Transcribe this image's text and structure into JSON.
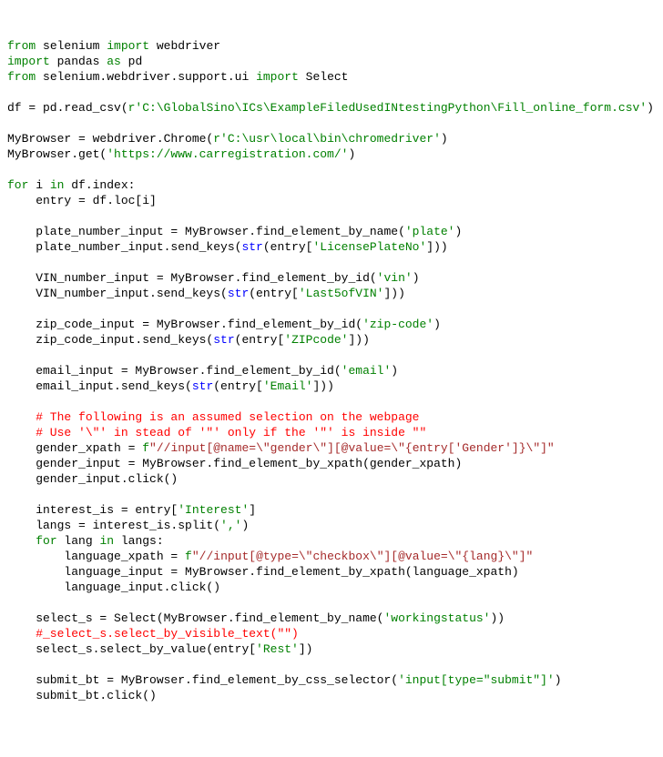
{
  "lines": [
    [
      {
        "t": "from",
        "c": "kw"
      },
      {
        "t": " selenium ",
        "c": "def"
      },
      {
        "t": "import",
        "c": "kw"
      },
      {
        "t": " webdriver",
        "c": "def"
      }
    ],
    [
      {
        "t": "import",
        "c": "kw"
      },
      {
        "t": " pandas ",
        "c": "def"
      },
      {
        "t": "as",
        "c": "kw"
      },
      {
        "t": " pd",
        "c": "def"
      }
    ],
    [
      {
        "t": "from",
        "c": "kw"
      },
      {
        "t": " selenium.webdriver.support.ui ",
        "c": "def"
      },
      {
        "t": "import",
        "c": "kw"
      },
      {
        "t": " Select",
        "c": "def"
      }
    ],
    [],
    [
      {
        "t": "df = pd.read_csv(",
        "c": "def"
      },
      {
        "t": "r'C:\\GlobalSino\\ICs\\ExampleFiledUsedINtestingPython\\Fill_online_form.csv'",
        "c": "str"
      },
      {
        "t": ")",
        "c": "def"
      }
    ],
    [],
    [
      {
        "t": "MyBrowser = webdriver.Chrome(",
        "c": "def"
      },
      {
        "t": "r'C:\\usr\\local\\bin\\chromedriver'",
        "c": "str"
      },
      {
        "t": ")",
        "c": "def"
      }
    ],
    [
      {
        "t": "MyBrowser.get(",
        "c": "def"
      },
      {
        "t": "'https://www.carregistration.com/'",
        "c": "str"
      },
      {
        "t": ")",
        "c": "def"
      }
    ],
    [],
    [
      {
        "t": "for",
        "c": "kw"
      },
      {
        "t": " i ",
        "c": "def"
      },
      {
        "t": "in",
        "c": "kw"
      },
      {
        "t": " df.index:",
        "c": "def"
      }
    ],
    [
      {
        "t": "    entry = df.loc[i]",
        "c": "def"
      }
    ],
    [],
    [
      {
        "t": "    plate_number_input = MyBrowser.find_element_by_name(",
        "c": "def"
      },
      {
        "t": "'plate'",
        "c": "str"
      },
      {
        "t": ")",
        "c": "def"
      }
    ],
    [
      {
        "t": "    plate_number_input.send_keys(",
        "c": "def"
      },
      {
        "t": "str",
        "c": "blue"
      },
      {
        "t": "(entry[",
        "c": "def"
      },
      {
        "t": "'LicensePlateNo'",
        "c": "str"
      },
      {
        "t": "]))",
        "c": "def"
      }
    ],
    [],
    [
      {
        "t": "    VIN_number_input = MyBrowser.find_element_by_id(",
        "c": "def"
      },
      {
        "t": "'vin'",
        "c": "str"
      },
      {
        "t": ")",
        "c": "def"
      }
    ],
    [
      {
        "t": "    VIN_number_input.send_keys(",
        "c": "def"
      },
      {
        "t": "str",
        "c": "blue"
      },
      {
        "t": "(entry[",
        "c": "def"
      },
      {
        "t": "'Last5ofVIN'",
        "c": "str"
      },
      {
        "t": "]))",
        "c": "def"
      }
    ],
    [],
    [
      {
        "t": "    zip_code_input = MyBrowser.find_element_by_id(",
        "c": "def"
      },
      {
        "t": "'zip-code'",
        "c": "str"
      },
      {
        "t": ")",
        "c": "def"
      }
    ],
    [
      {
        "t": "    zip_code_input.send_keys(",
        "c": "def"
      },
      {
        "t": "str",
        "c": "blue"
      },
      {
        "t": "(entry[",
        "c": "def"
      },
      {
        "t": "'ZIPcode'",
        "c": "str"
      },
      {
        "t": "]))",
        "c": "def"
      }
    ],
    [],
    [
      {
        "t": "    email_input = MyBrowser.find_element_by_id(",
        "c": "def"
      },
      {
        "t": "'email'",
        "c": "str"
      },
      {
        "t": ")",
        "c": "def"
      }
    ],
    [
      {
        "t": "    email_input.send_keys(",
        "c": "def"
      },
      {
        "t": "str",
        "c": "blue"
      },
      {
        "t": "(entry[",
        "c": "def"
      },
      {
        "t": "'Email'",
        "c": "str"
      },
      {
        "t": "]))",
        "c": "def"
      }
    ],
    [],
    [
      {
        "t": "    # The following is an assumed selection on the webpage",
        "c": "cmt"
      }
    ],
    [
      {
        "t": "    # Use '\\\"' in stead of '\"' only if the '\"' is inside \"\"",
        "c": "cmt"
      }
    ],
    [
      {
        "t": "    gender_xpath = ",
        "c": "def"
      },
      {
        "t": "f",
        "c": "fkw"
      },
      {
        "t": "\"//input[@name=\\\"gender\\\"][@value=\\\"{entry['Gender']}\\\"]\"",
        "c": "fstr"
      }
    ],
    [
      {
        "t": "    gender_input = MyBrowser.find_element_by_xpath(gender_xpath)",
        "c": "def"
      }
    ],
    [
      {
        "t": "    gender_input.click()",
        "c": "def"
      }
    ],
    [],
    [
      {
        "t": "    interest_is = entry[",
        "c": "def"
      },
      {
        "t": "'Interest'",
        "c": "str"
      },
      {
        "t": "]",
        "c": "def"
      }
    ],
    [
      {
        "t": "    langs = interest_is.split(",
        "c": "def"
      },
      {
        "t": "','",
        "c": "str"
      },
      {
        "t": ")",
        "c": "def"
      }
    ],
    [
      {
        "t": "    ",
        "c": "def"
      },
      {
        "t": "for",
        "c": "kw"
      },
      {
        "t": " lang ",
        "c": "def"
      },
      {
        "t": "in",
        "c": "kw"
      },
      {
        "t": " langs:",
        "c": "def"
      }
    ],
    [
      {
        "t": "        language_xpath = ",
        "c": "def"
      },
      {
        "t": "f",
        "c": "fkw"
      },
      {
        "t": "\"//input[@type=\\\"checkbox\\\"][@value=\\\"{lang}\\\"]\"",
        "c": "fstr"
      }
    ],
    [
      {
        "t": "        language_input = MyBrowser.find_element_by_xpath(language_xpath)",
        "c": "def"
      }
    ],
    [
      {
        "t": "        language_input.click()",
        "c": "def"
      }
    ],
    [],
    [
      {
        "t": "    select_s = Select(MyBrowser.find_element_by_name(",
        "c": "def"
      },
      {
        "t": "'workingstatus'",
        "c": "str"
      },
      {
        "t": "))",
        "c": "def"
      }
    ],
    [
      {
        "t": "    #_select_s.select_by_visible_text(\"\")",
        "c": "cmt"
      }
    ],
    [
      {
        "t": "    select_s.select_by_value(entry[",
        "c": "def"
      },
      {
        "t": "'Rest'",
        "c": "str"
      },
      {
        "t": "])",
        "c": "def"
      }
    ],
    [],
    [
      {
        "t": "    submit_bt = MyBrowser.find_element_by_css_selector(",
        "c": "def"
      },
      {
        "t": "'input[type=\"submit\"]'",
        "c": "str"
      },
      {
        "t": ")",
        "c": "def"
      }
    ],
    [
      {
        "t": "    submit_bt.click()",
        "c": "def"
      }
    ]
  ]
}
